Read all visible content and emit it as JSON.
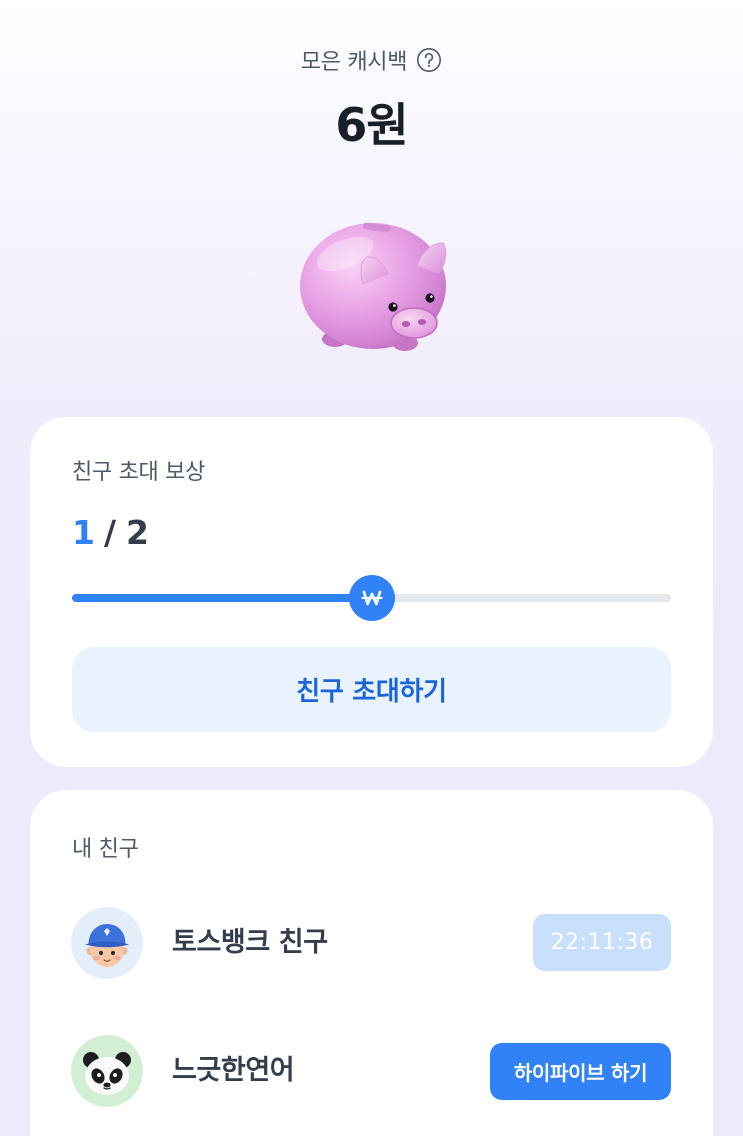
{
  "header": {
    "title": "모은 캐시백",
    "help_icon": "question-circle-icon",
    "amount": "6원"
  },
  "hero": {
    "image": "piggy-bank-image"
  },
  "invite_card": {
    "title": "친구 초대 보상",
    "progress": {
      "current": "1",
      "separator": "/",
      "total": "2",
      "fraction": 0.5,
      "knob_icon": "won-icon"
    },
    "button_label": "친구 초대하기"
  },
  "friends_card": {
    "title": "내 친구",
    "friends": [
      {
        "name": "토스뱅크 친구",
        "avatar": "boy-with-cap-avatar",
        "action": {
          "label": "22:11:36",
          "disabled": true
        }
      },
      {
        "name": "느긋한연어",
        "avatar": "panda-avatar",
        "action": {
          "label": "하이파이브 하기",
          "disabled": false
        }
      }
    ]
  },
  "colors": {
    "accent": "#3182f6",
    "accent_light": "#e8f3ff",
    "timer_badge": "#c9e0fd",
    "background_tint": "#eee9fb"
  }
}
